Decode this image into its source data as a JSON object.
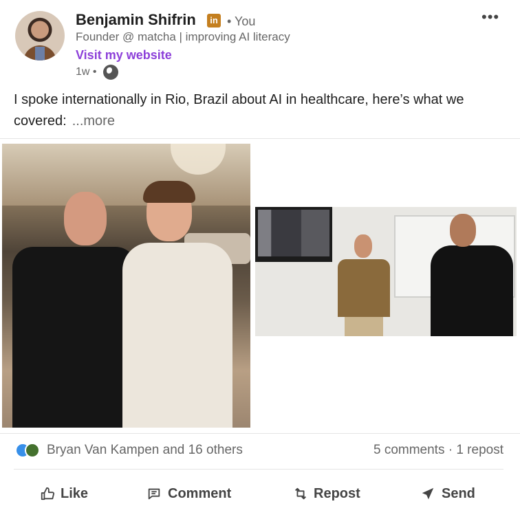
{
  "author": {
    "name": "Benjamin Shifrin",
    "badge": "in",
    "degree": "• You",
    "headline": "Founder @ matcha | improving AI literacy",
    "website_label": "Visit my website",
    "time": "1w •"
  },
  "post": {
    "text": "I spoke internationally in Rio, Brazil about AI in healthcare, here’s what we covered:",
    "more_label": "...more"
  },
  "social": {
    "reactors": "Bryan Van Kampen and 16 others",
    "counts": "5 comments · 1 repost"
  },
  "actions": {
    "like": "Like",
    "comment": "Comment",
    "repost": "Repost",
    "send": "Send"
  },
  "colors": {
    "link_purple": "#8c3fd9",
    "linkedin_badge": "#c47f1f",
    "muted_text": "#666666"
  },
  "icons": [
    "overflow-menu-icon",
    "globe-icon",
    "like-icon",
    "comment-icon",
    "repost-icon",
    "send-icon"
  ]
}
